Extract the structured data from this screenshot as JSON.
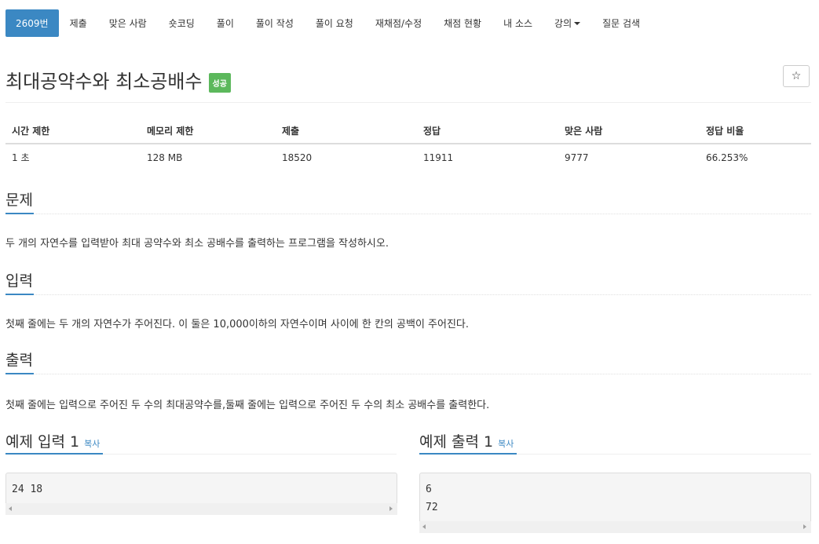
{
  "nav": {
    "tabs": [
      "2609번",
      "제출",
      "맞은 사람",
      "숏코딩",
      "풀이",
      "풀이 작성",
      "풀이 요청",
      "재채점/수정",
      "채점 현황",
      "내 소스",
      "강의",
      "질문 검색"
    ]
  },
  "problem": {
    "title": "최대공약수와 최소공배수",
    "badge": "성공",
    "star": "☆"
  },
  "info_table": {
    "headers": [
      "시간 제한",
      "메모리 제한",
      "제출",
      "정답",
      "맞은 사람",
      "정답 비율"
    ],
    "row": [
      "1 초",
      "128 MB",
      "18520",
      "11911",
      "9777",
      "66.253%"
    ]
  },
  "sections": {
    "problem_h": "문제",
    "problem_text": "두 개의 자연수를 입력받아 최대 공약수와 최소 공배수를 출력하는 프로그램을 작성하시오.",
    "input_h": "입력",
    "input_text": "첫째 줄에는 두 개의 자연수가 주어진다. 이 둘은 10,000이하의 자연수이며 사이에 한 칸의 공백이 주어진다.",
    "output_h": "출력",
    "output_text": "첫째 줄에는 입력으로 주어진 두 수의 최대공약수를,둘째 줄에는 입력으로 주어진 두 수의 최소 공배수를 출력한다."
  },
  "examples": {
    "input_h": "예제 입력 1",
    "output_h": "예제 출력 1",
    "copy_label": "복사",
    "input_text": "24 18",
    "output_text": "6\n72"
  },
  "colors": {
    "accent": "#3b88c3",
    "success": "#5cb85c"
  }
}
